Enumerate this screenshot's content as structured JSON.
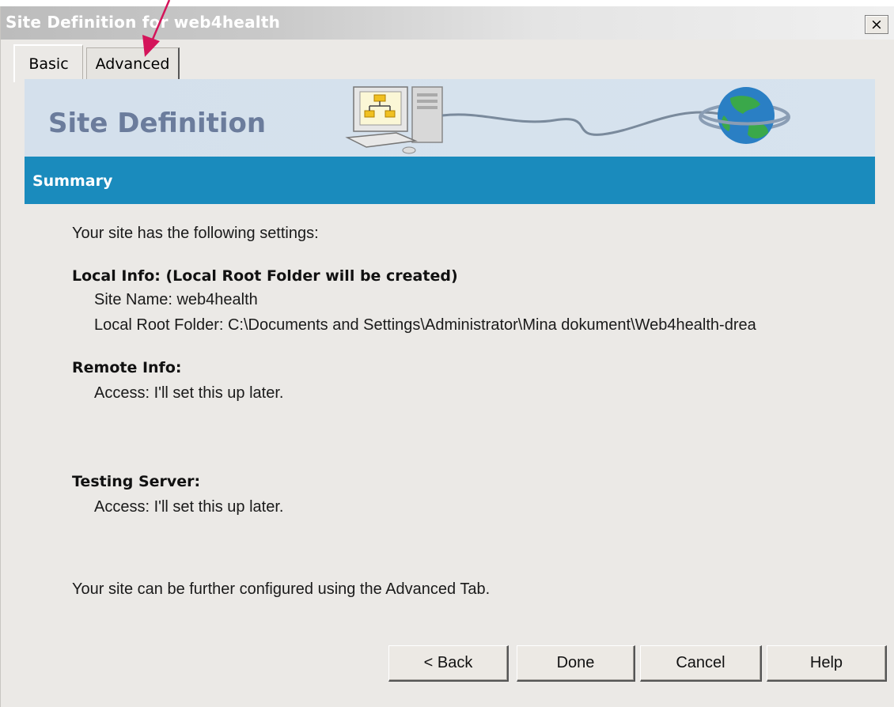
{
  "window": {
    "title": "Site Definition for web4health",
    "close_symbol": "×"
  },
  "tabs": [
    {
      "label": "Basic"
    },
    {
      "label": "Advanced"
    }
  ],
  "banner": {
    "title": "Site Definition"
  },
  "section": {
    "title": "Summary"
  },
  "summary": {
    "intro": "Your site has the following settings:",
    "local_heading": "Local Info: (Local Root Folder will be created)",
    "site_name": "Site Name: web4health",
    "local_root": "Local Root Folder: C:\\Documents and Settings\\Administrator\\Mina dokument\\Web4health-dreа",
    "remote_heading": "Remote Info:",
    "remote_access": "Access: I'll set this up later.",
    "testing_heading": "Testing Server:",
    "testing_access": "Access: I'll set this up later.",
    "footer_note": "Your site can be further configured using the Advanced Tab."
  },
  "buttons": {
    "back": "< Back",
    "done": "Done",
    "cancel": "Cancel",
    "help": "Help"
  },
  "colors": {
    "summary_bar": "#1a8bbd",
    "banner_title": "#6b7c9c",
    "annotation_arrow": "#d4145a"
  }
}
